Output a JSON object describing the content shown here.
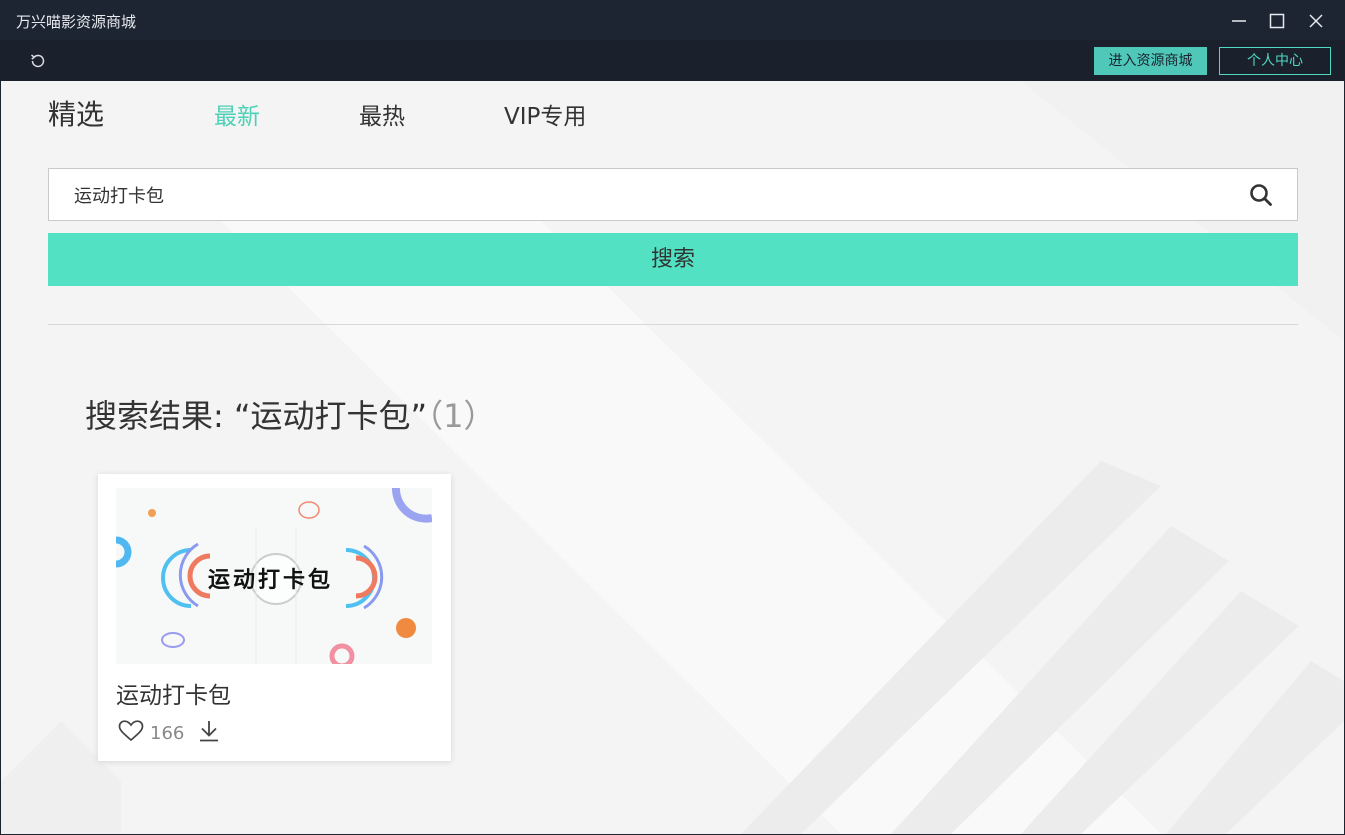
{
  "window": {
    "title": "万兴喵影资源商城"
  },
  "toolbar": {
    "store_button": "进入资源商城",
    "personal_button": "个人中心"
  },
  "tabs": [
    {
      "label": "精选"
    },
    {
      "label": "最新",
      "active": true
    },
    {
      "label": "最热"
    },
    {
      "label": "VIP专用"
    }
  ],
  "search": {
    "value": "运动打卡包",
    "button_label": "搜索"
  },
  "results": {
    "heading_prefix": "搜索结果: “运动打卡包”",
    "count": "（1）"
  },
  "cards": [
    {
      "thumb_text": "运动打卡包",
      "title": "运动打卡包",
      "likes": "166"
    }
  ],
  "colors": {
    "accent": "#4fd1b7",
    "search_button": "#52e2c3",
    "titlebar": "#1d2532",
    "store_button": "#4fc8b9"
  },
  "icons": [
    "refresh-icon",
    "minimize-icon",
    "maximize-icon",
    "close-icon",
    "search-icon",
    "heart-icon",
    "download-icon",
    "play-icon"
  ]
}
